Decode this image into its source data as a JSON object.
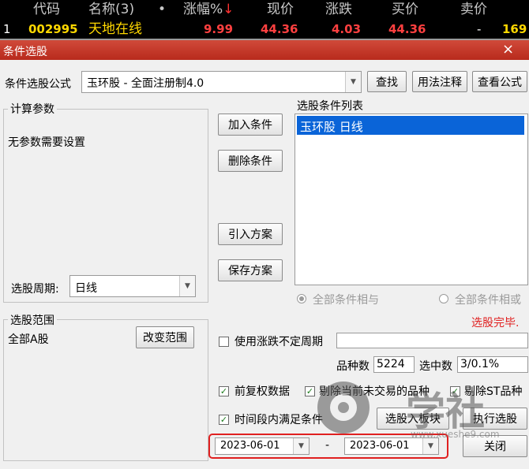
{
  "stock_header": {
    "columns": [
      "代码",
      "名称(3)",
      "•",
      "涨幅%",
      "现价",
      "涨跌",
      "买价",
      "卖价"
    ],
    "sort_indicator": "↓"
  },
  "stock_row": {
    "index": "1",
    "code": "002995",
    "name": "天地在线",
    "change_pct": "9.99",
    "price": "44.36",
    "change": "4.03",
    "bid": "44.36",
    "ask": "-",
    "extra": "169"
  },
  "window": {
    "title": "条件选股",
    "close_glyph": "×"
  },
  "formula": {
    "label": "条件选股公式",
    "value": "玉环股      - 全面注册制4.0",
    "find_btn": "查找",
    "usage_btn": "用法注释",
    "view_btn": "查看公式"
  },
  "params": {
    "group_title": "计算参数",
    "text": "无参数需要设置",
    "period_label": "选股周期:",
    "period_value": "日线"
  },
  "actions": {
    "add": "加入条件",
    "delete": "删除条件",
    "import": "引入方案",
    "save": "保存方案"
  },
  "conditions": {
    "title": "选股条件列表",
    "items": [
      "玉环股  日线"
    ],
    "radio_and": "全部条件相与",
    "radio_or": "全部条件相或",
    "status": "选股完毕."
  },
  "scope": {
    "group_title": "选股范围",
    "value": "全部A股",
    "change_btn": "改变范围"
  },
  "options": {
    "uncertain_period": "使用涨跌不定周期",
    "count_label": "品种数",
    "count_value": "5224",
    "selected_label": "选中数",
    "selected_value": "3/0.1%",
    "fq": "前复权数据",
    "exclude_untraded": "剔除当前未交易的品种",
    "exclude_st": "剔除ST品种",
    "period_cond": "时间段内满足条件",
    "to_block_btn": "选股入板块",
    "run_btn": "执行选股",
    "close_btn": "关闭",
    "check_glyph": "✓",
    "dropdown_glyph": "▼"
  },
  "daterange": {
    "from": "2023-06-01",
    "sep": "-",
    "to": "2023-06-01"
  },
  "watermark": {
    "text": "学社",
    "url": "www.xueshe9.com"
  },
  "colors": {
    "up": "#ff3030",
    "code": "#ffd800",
    "price": "#ff4040",
    "highlight_border": "#e02020",
    "selection": "#0a64d8"
  }
}
